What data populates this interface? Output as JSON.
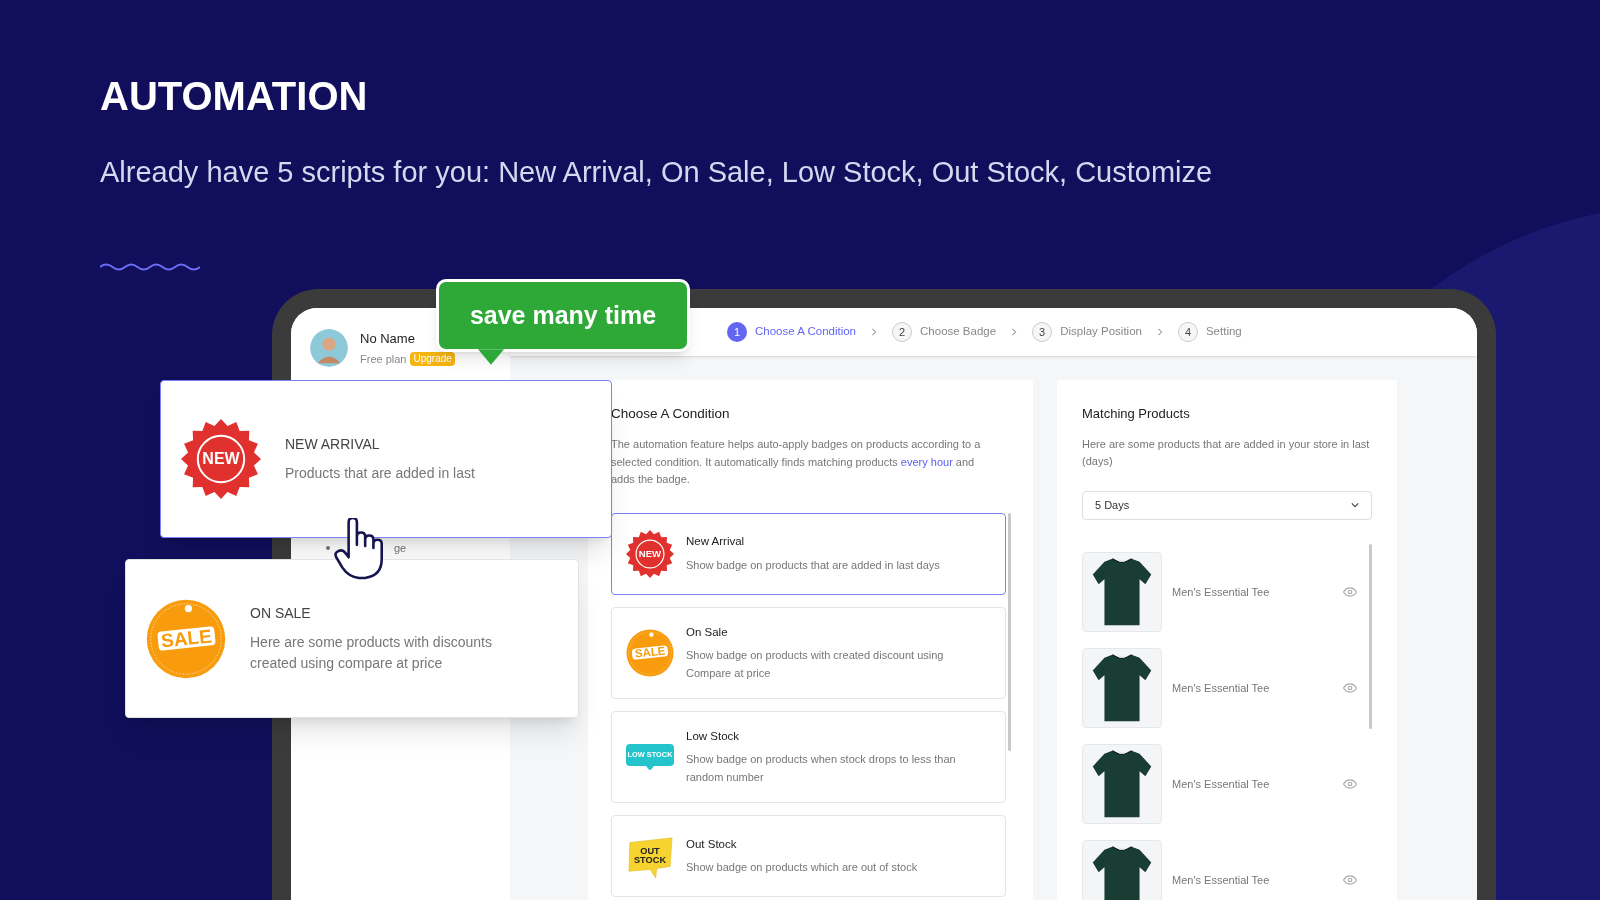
{
  "heading": "AUTOMATION",
  "subheading": "Already have 5 scripts for you: New Arrival, On Sale, Low Stock, Out Stock, Customize",
  "callout": "save many time",
  "sidebar": {
    "user_name": "No Name",
    "plan": "Free plan",
    "upgrade": "Upgrade",
    "items": [
      {
        "label": "ge"
      }
    ]
  },
  "steps": [
    {
      "number": "1",
      "label": "Choose A Condition",
      "selected": true
    },
    {
      "number": "2",
      "label": "Choose Badge",
      "selected": false
    },
    {
      "number": "3",
      "label": "Display Position",
      "selected": false
    },
    {
      "number": "4",
      "label": "Setting",
      "selected": false
    }
  ],
  "condition_panel": {
    "title": "Choose A Condition",
    "description_before": "The automation feature helps auto-apply badges on products according to a selected condition. It automatically finds matching products ",
    "link": "every hour",
    "description_after": " and adds the badge.",
    "conditions": [
      {
        "title": "New Arrival",
        "description": "Show badge on products that are added in last days",
        "selected": true,
        "badge": {
          "kind": "starburst",
          "text": "NEW"
        }
      },
      {
        "title": "On Sale",
        "description": "Show badge on products with created discount using Compare at price",
        "selected": false,
        "badge": {
          "kind": "tag",
          "text": "SALE"
        }
      },
      {
        "title": "Low Stock",
        "description": "Show badge on products when stock drops to less than random number",
        "selected": false,
        "badge": {
          "kind": "ribbon",
          "text": "LOW STOCK"
        }
      },
      {
        "title": "Out Stock",
        "description": "Show badge on products which are out of stock",
        "selected": false,
        "badge": {
          "kind": "sticker",
          "text": "OUT STOCK"
        }
      }
    ]
  },
  "products_panel": {
    "title": "Matching Products",
    "description": "Here are some products that are added in your store in last (days)",
    "select": {
      "value": "5 Days"
    },
    "products": [
      {
        "name": "Men's Essential Tee"
      },
      {
        "name": "Men's Essential Tee"
      },
      {
        "name": "Men's Essential Tee"
      },
      {
        "name": "Men's Essential Tee"
      }
    ]
  },
  "feature_cards": [
    {
      "title": "NEW ARRIVAL",
      "description": "Products that are added in last",
      "selected": true,
      "badge": {
        "kind": "starburst",
        "text": "NEW"
      }
    },
    {
      "title": "ON SALE",
      "description": "Here are some products with discounts created using compare at price",
      "selected": false,
      "badge": {
        "kind": "tag",
        "text": "SALE"
      }
    }
  ]
}
